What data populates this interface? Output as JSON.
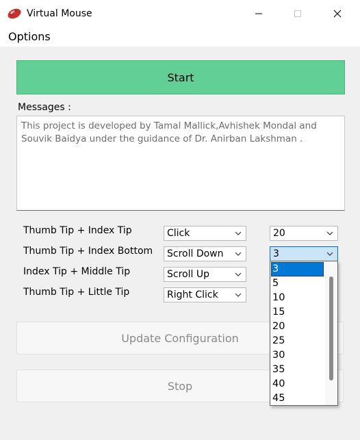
{
  "window": {
    "title": "Virtual Mouse"
  },
  "menu": {
    "options_label": "Options"
  },
  "start_button": {
    "label": "Start"
  },
  "messages": {
    "label": "Messages :",
    "text": "This project is developed by Tamal Mallick,Avhishek Mondal and Souvik Baidya under the guidance of Dr. Anirban Lakshman  ."
  },
  "gestures": [
    {
      "label": "Thumb Tip + Index Tip",
      "action": "Click",
      "value": "20"
    },
    {
      "label": "Thumb Tip + Index Bottom",
      "action": "Scroll Down",
      "value": "3"
    },
    {
      "label": "Index Tip + Middle Tip",
      "action": "Scroll Up"
    },
    {
      "label": "Thumb Tip + Little Tip",
      "action": "Right Click"
    }
  ],
  "value_dropdown": {
    "selected": "3",
    "options": [
      "3",
      "5",
      "10",
      "15",
      "20",
      "25",
      "30",
      "35",
      "40",
      "45"
    ]
  },
  "update_button": {
    "label": "Update Configuration"
  },
  "stop_button": {
    "label": "Stop"
  },
  "colors": {
    "start_green": "#62cf97",
    "selection_blue": "#0078d7"
  }
}
